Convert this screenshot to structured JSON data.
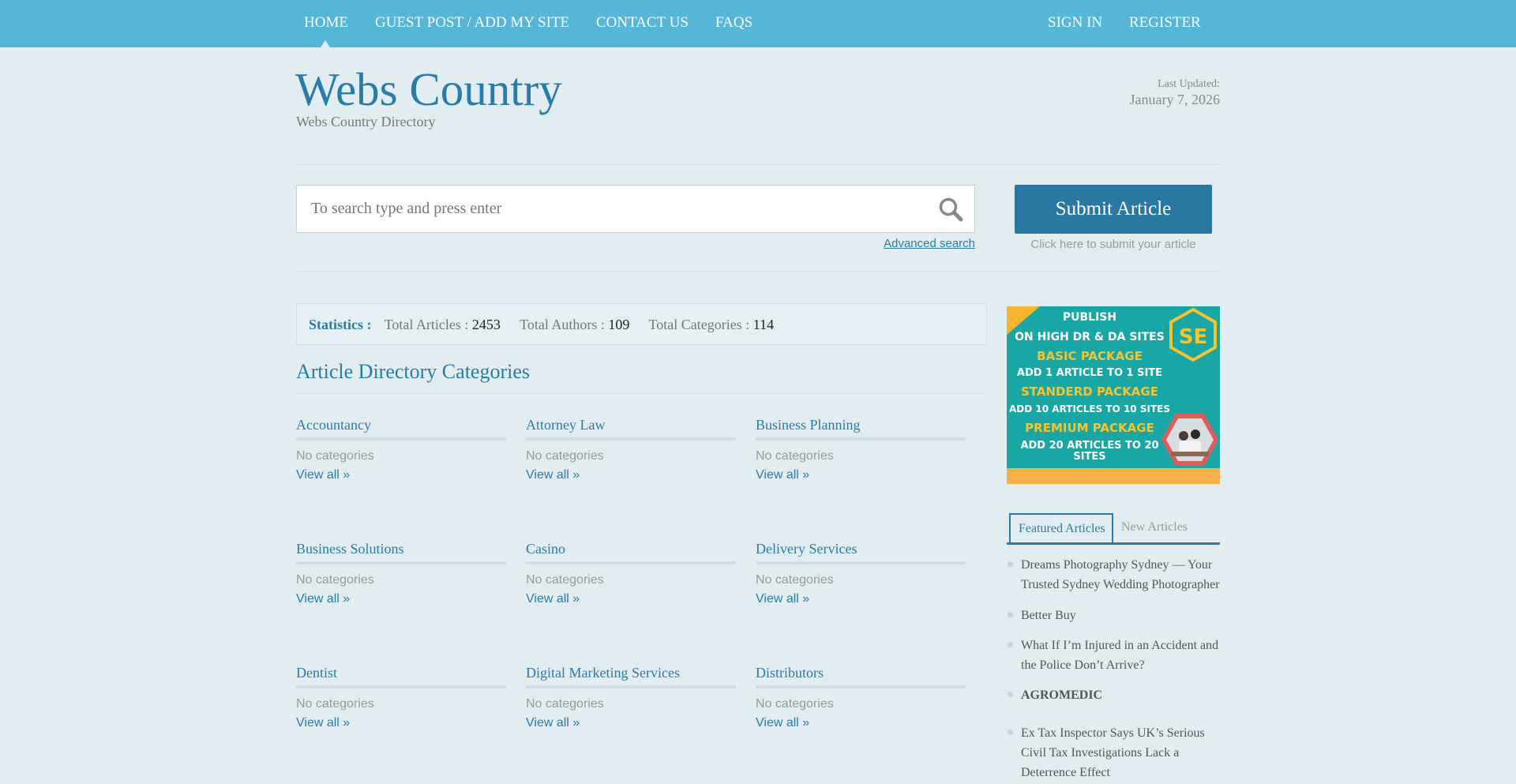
{
  "nav": {
    "left": [
      "HOME",
      "GUEST POST / ADD MY SITE",
      "CONTACT US",
      "FAQS"
    ],
    "right": [
      "SIGN IN",
      "REGISTER"
    ]
  },
  "header": {
    "title": "Webs Country",
    "tagline": "Webs Country Directory",
    "updated_label": "Last Updated:",
    "updated_date": "January 7, 2026"
  },
  "search": {
    "placeholder": "To search type and press enter",
    "advanced_label": "Advanced search"
  },
  "submit": {
    "label": "Submit Article",
    "hint": "Click here to submit your article"
  },
  "stats": {
    "label": "Statistics :",
    "articles_label": "Total Articles :",
    "articles_value": "2453",
    "authors_label": "Total Authors :",
    "authors_value": "109",
    "categories_label": "Total Categories :",
    "categories_value": "114"
  },
  "categories": {
    "heading": "Article Directory Categories",
    "sub_label": "No categories",
    "view_all": "View all »",
    "items": [
      "Accountancy",
      "Attorney Law",
      "Business Planning",
      "Business Solutions",
      "Casino",
      "Delivery Services",
      "Dentist",
      "Digital Marketing Services",
      "Distributors"
    ]
  },
  "ad": {
    "lines": [
      "PUBLISH",
      "ON HIGH DR & DA SITES",
      "BASIC PACKAGE",
      "ADD 1 ARTICLE TO 1 SITE",
      "STANDERD PACKAGE",
      "ADD 10 ARTICLES TO 10 SITES",
      "PREMIUM PACKAGE",
      "ADD 20 ARTICLES TO 20",
      "SITES"
    ],
    "logo_text": "SE",
    "colors": {
      "background": "#19a7a6",
      "accent": "#f7c32e",
      "white": "#ffffff",
      "bottom": "#f6b04a"
    }
  },
  "tabs": {
    "featured": "Featured Articles",
    "new": "New Articles"
  },
  "articles": [
    "Dreams Photography Sydney — Your Trusted Sydney Wedding Photographer",
    "Better Buy",
    "What If I’m Injured in an Accident and the Police Don’t Arrive?",
    "AGROMEDIC",
    "Ex Tax Inspector Says UK’s Serious Civil Tax Investigations Lack a Deterrence Effect"
  ],
  "colors": {
    "nav_bg": "#56b6d8",
    "page_bg": "#e2edf2",
    "brand": "#2a7ca8",
    "button": "#2a77a3"
  }
}
